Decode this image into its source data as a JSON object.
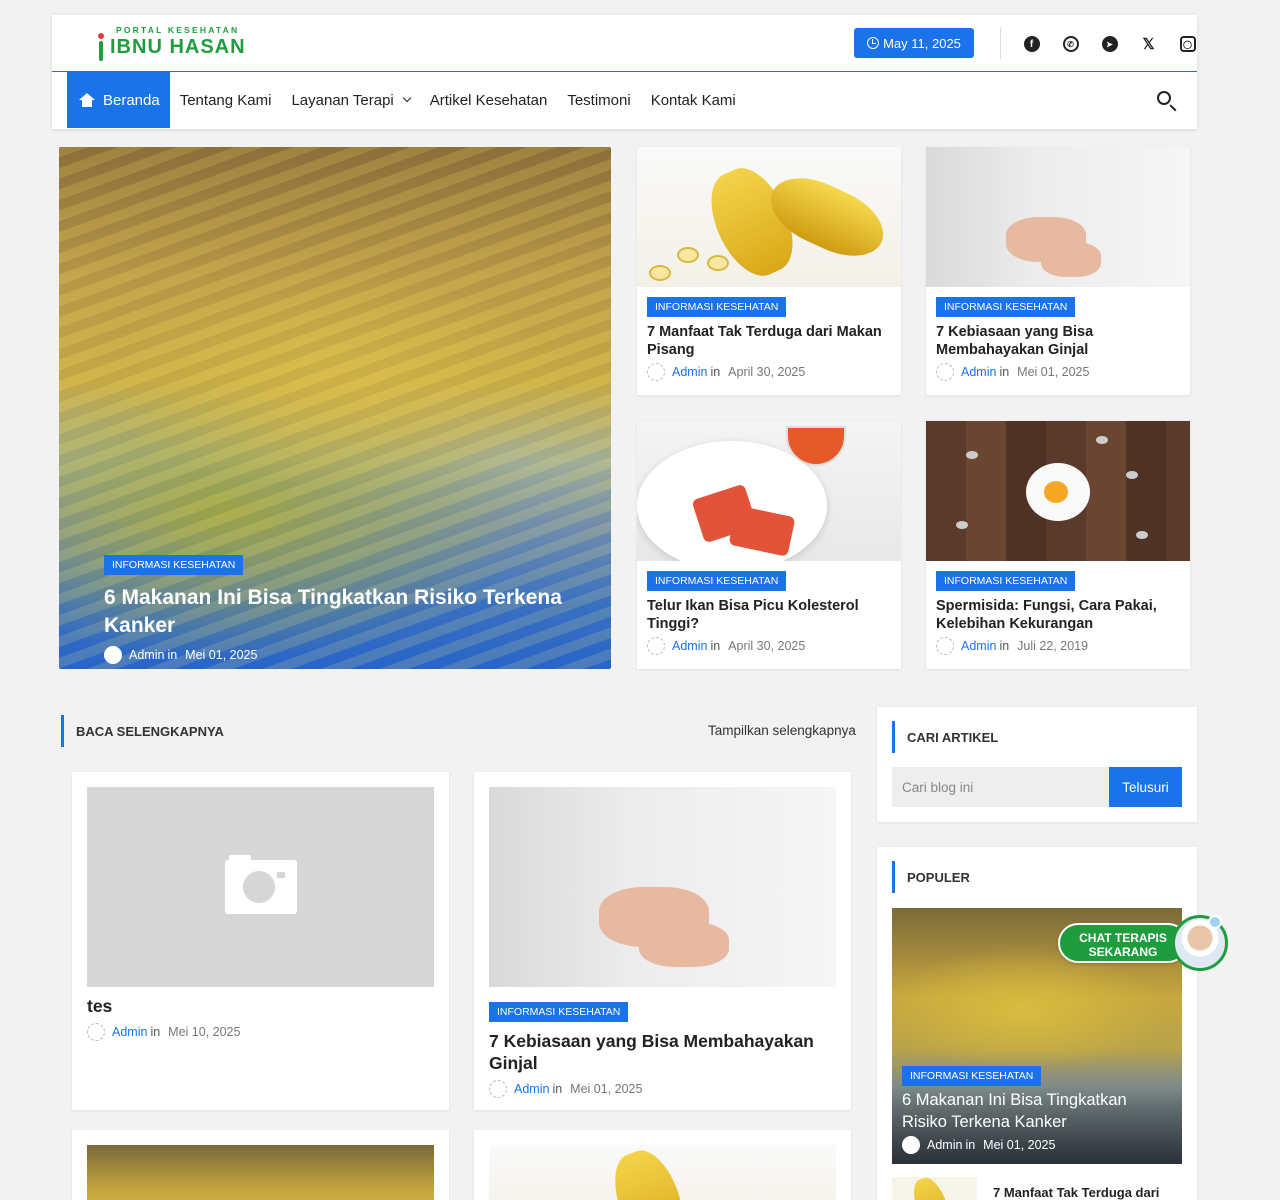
{
  "brand": {
    "tagline": "PORTAL KESEHATAN",
    "name": "IBNU HASAN"
  },
  "header": {
    "date": "May 11, 2025",
    "socials": [
      "facebook-icon",
      "whatsapp-icon",
      "telegram-icon",
      "x-icon",
      "instagram-icon"
    ]
  },
  "nav": {
    "items": [
      {
        "label": "Beranda",
        "active": true
      },
      {
        "label": "Tentang Kami"
      },
      {
        "label": "Layanan Terapi",
        "dropdown": true
      },
      {
        "label": "Artikel Kesehatan"
      },
      {
        "label": "Testimoni"
      },
      {
        "label": "Kontak Kami"
      }
    ]
  },
  "featured": {
    "hero": {
      "label": "INFORMASI KESEHATAN",
      "title": "6 Makanan Ini Bisa Tingkatkan Risiko Terkena Kanker",
      "author": "Admin",
      "in": "in",
      "date": "Mei 01, 2025"
    },
    "cards": [
      {
        "label": "INFORMASI KESEHATAN",
        "title": "7 Manfaat Tak Terduga dari Makan Pisang",
        "author": "Admin",
        "in": "in",
        "date": "April 30, 2025"
      },
      {
        "label": "INFORMASI KESEHATAN",
        "title": "7 Kebiasaan yang Bisa Membahayakan Ginjal",
        "author": "Admin",
        "in": "in",
        "date": "Mei 01, 2025"
      },
      {
        "label": "INFORMASI KESEHATAN",
        "title": "Telur Ikan Bisa Picu Kolesterol Tinggi?",
        "author": "Admin",
        "in": "in",
        "date": "April 30, 2025"
      },
      {
        "label": "INFORMASI KESEHATAN",
        "title": "Spermisida: Fungsi, Cara Pakai, Kelebihan Kekurangan",
        "author": "Admin",
        "in": "in",
        "date": "Juli 22, 2019"
      }
    ]
  },
  "section": {
    "title": "BACA SELENGKAPNYA",
    "show_all": "Tampilkan selengkapnya",
    "posts": [
      {
        "title": "tes",
        "author": "Admin",
        "in": "in",
        "date": "Mei 10, 2025"
      },
      {
        "label": "INFORMASI KESEHATAN",
        "title": "7 Kebiasaan yang Bisa Membahayakan Ginjal",
        "author": "Admin",
        "in": "in",
        "date": "Mei 01, 2025"
      }
    ]
  },
  "sidebar": {
    "search": {
      "title": "CARI ARTIKEL",
      "placeholder": "Cari blog ini",
      "button": "Telusuri"
    },
    "popular": {
      "title": "POPULER",
      "top": {
        "label": "INFORMASI KESEHATAN",
        "title": "6 Makanan Ini Bisa Tingkatkan Risiko Terkena Kanker",
        "author": "Admin",
        "in": "in",
        "date": "Mei 01, 2025"
      },
      "next_title": "7 Manfaat Tak Terduga dari"
    }
  },
  "chat": {
    "label": "CHAT TERAPIS SEKARANG"
  },
  "colors": {
    "accent": "#1a73e8",
    "brand_green": "#1f9d3e"
  }
}
